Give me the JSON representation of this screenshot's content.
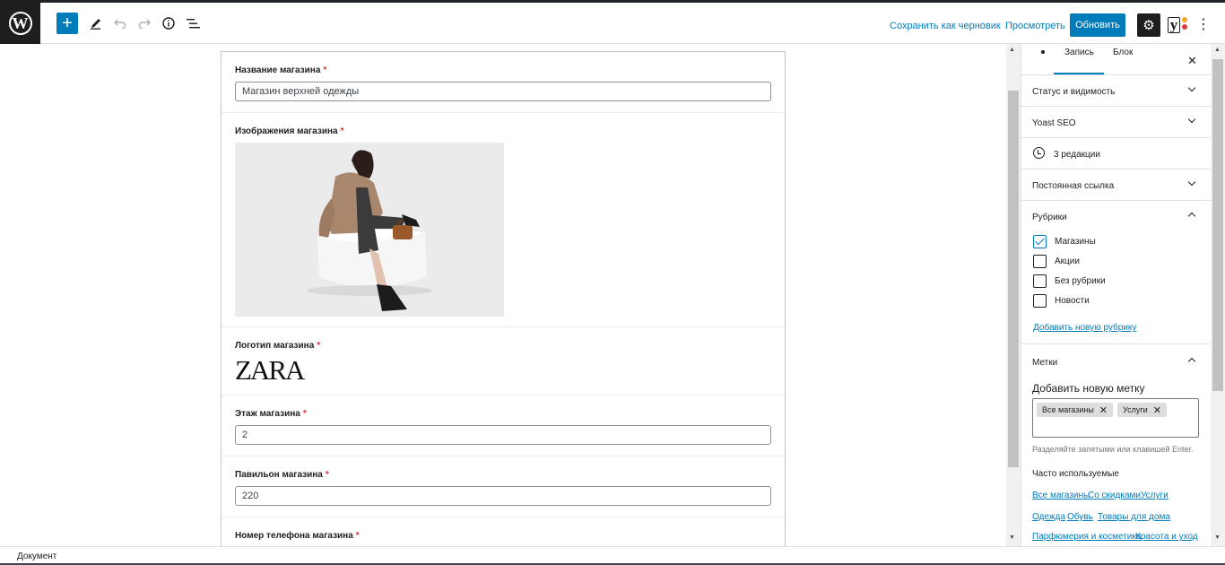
{
  "toolbar": {
    "save_draft": "Сохранить как черновик",
    "preview": "Просмотреть",
    "update": "Обновить"
  },
  "form": {
    "fields": [
      {
        "label": "Название магазина",
        "required": "*",
        "value": "Магазин верхней одежды"
      },
      {
        "label": "Изображения магазина",
        "required": "*"
      },
      {
        "label": "Логотип магазина",
        "required": "*",
        "logo_text": "ZARA"
      },
      {
        "label": "Этаж магазина",
        "required": "*",
        "value": "2"
      },
      {
        "label": "Павильон магазина",
        "required": "*",
        "value": "220"
      },
      {
        "label": "Номер телефона магазина",
        "required": "*"
      }
    ]
  },
  "sidebar": {
    "tabs": {
      "post": "Запись",
      "block": "Блок"
    },
    "panels": {
      "status": "Статус и видимость",
      "yoast": "Yoast SEO",
      "revisions": "3 редакции",
      "permalink": "Постоянная ссылка",
      "categories": "Рубрики"
    },
    "categories": [
      {
        "label": "Магазины",
        "checked": true
      },
      {
        "label": "Акции",
        "checked": false
      },
      {
        "label": "Без рубрики",
        "checked": false
      },
      {
        "label": "Новости",
        "checked": false
      }
    ],
    "add_category": "Добавить новую рубрику",
    "tags": {
      "title": "Метки",
      "add_label": "Добавить новую метку",
      "chips": [
        "Все магазины",
        "Услуги"
      ],
      "help": "Разделяйте запятыми или клавишей Enter.",
      "frequent_title": "Часто используемые",
      "frequent": [
        "Все магазины",
        "Со скидками",
        "Услуги",
        "Одежда",
        "Обувь",
        "Товары для дома",
        "Парфюмерия и косметика",
        "Красота и уход"
      ]
    }
  },
  "footer": {
    "breadcrumb": "Документ"
  },
  "colors": {
    "accent": "#007cba",
    "dark": "#1e1e1e",
    "required": "#d63638"
  }
}
